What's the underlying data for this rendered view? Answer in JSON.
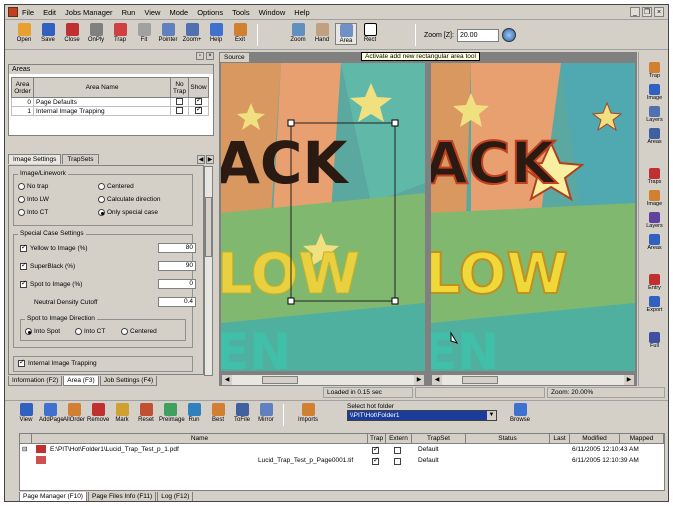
{
  "menu": [
    "File",
    "Edit",
    "Jobs Manager",
    "Run",
    "View",
    "Mode",
    "Options",
    "Tools",
    "Window",
    "Help"
  ],
  "toolbar": {
    "buttons": [
      "Open",
      "Save",
      "Close",
      "OnPly",
      "Trap",
      "Fit",
      "Pointer",
      "Zoom+",
      "Help",
      "Exit",
      "Zoom",
      "Hand",
      "Area",
      "Rect"
    ],
    "zoom_label": "Zoom [Z]:",
    "zoom_value": "20.00"
  },
  "areas_panel": {
    "caption": "Areas",
    "headers": {
      "order": "Area Order",
      "name": "Area Name",
      "notrap": "No Trap",
      "show": "Show"
    },
    "rows": [
      {
        "order": "0",
        "name": "Page Defaults",
        "notrap": false,
        "show": true
      },
      {
        "order": "1",
        "name": "Internal Image Trapping",
        "notrap": false,
        "show": true
      }
    ]
  },
  "panel_tabs": [
    "Image Settings",
    "TrapSets"
  ],
  "image_settings": {
    "group_linework": "Image/Linework",
    "radios": [
      {
        "label": "No trap",
        "on": false
      },
      {
        "label": "Centered",
        "on": false
      },
      {
        "label": "Into LW",
        "on": false
      },
      {
        "label": "Calculate direction",
        "on": false
      },
      {
        "label": "Into CT",
        "on": false
      },
      {
        "label": "Only special case",
        "on": true
      }
    ],
    "group_special": "Special Case Settings",
    "fields": [
      {
        "label": "Yellow to Image (%)",
        "checked": true,
        "value": "80"
      },
      {
        "label": "SuperBlack (%)",
        "checked": true,
        "value": "90"
      },
      {
        "label": "Spot to Image (%)",
        "checked": true,
        "value": "0"
      },
      {
        "label": "Neutral Density Cutoff",
        "checked": false,
        "value": "0.4"
      }
    ],
    "group_spot": "Spot to Image Direction",
    "spot_radios": [
      {
        "label": "Into Spot",
        "on": true
      },
      {
        "label": "Into CT",
        "on": false
      },
      {
        "label": "Centered",
        "on": false
      }
    ],
    "internal_trapping": "Internal Image Trapping"
  },
  "left_bottom_tabs": [
    "Information (F2)",
    "Area (F3)",
    "Job Settings (F4)"
  ],
  "document_tab": "Source",
  "tooltip": "Activate add new rectangular area tool",
  "right_tools": [
    "Trap",
    "Image",
    "Layers",
    "Areas",
    "Traps",
    "Image",
    "Layers",
    "Areas",
    "Entry",
    "Export",
    "Full"
  ],
  "status": {
    "loaded": "Loaded in 0.15 sec",
    "zoom": "Zoom: 20.00%"
  },
  "bottom_toolbar": {
    "buttons": [
      "View",
      "AddPage",
      "AllOrder",
      "Remove",
      "Mark",
      "Reset",
      "Preimage",
      "Run",
      "Best",
      "ToFile",
      "Mirror",
      "Imports"
    ],
    "hotfolder_label": "Select hot folder",
    "hotfolder_value": "\\\\PIT\\Hot\\Folder1",
    "browse": "Browse"
  },
  "file_list": {
    "headers": [
      "Name",
      "Trap",
      "Extern",
      "TrapSet",
      "Status",
      "Last",
      "Modified",
      "Mapped"
    ],
    "rows": [
      {
        "name": "E:\\PIT\\Hot\\Folder1\\Lucid_Trap_Test_p_1.pdf",
        "trapset": "Default",
        "date": "6/11/2005 12:10:43 AM"
      },
      {
        "name": "Lucid_Trap_Test_p_Page0001.tif",
        "trapset": "Default",
        "date": "6/11/2005 12:10:39 AM"
      }
    ]
  },
  "bottom_tabs": [
    "Page Manager (F10)",
    "Page Files Info (F11)",
    "Log (F12)"
  ],
  "art_text": {
    "top": "ACK",
    "middle": "LOW",
    "bottom": "EN"
  }
}
